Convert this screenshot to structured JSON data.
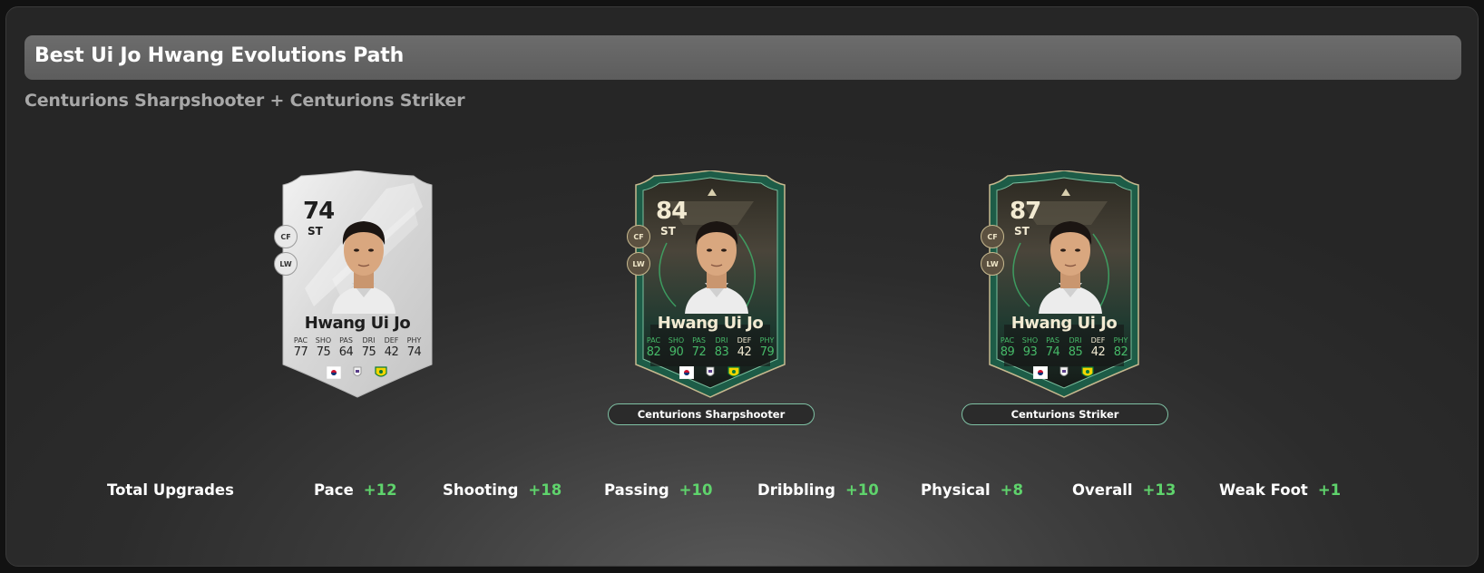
{
  "header": {
    "title": "Best Ui Jo Hwang Evolutions Path",
    "subtitle": "Centurions Sharpshooter + Centurions Striker"
  },
  "colors": {
    "accent_green": "#5fd36c",
    "button_border": "#7fc1a4",
    "card_green": "#1f5a45"
  },
  "cards": [
    {
      "rating": "74",
      "position": "ST",
      "alt_positions": [
        "CF",
        "LW"
      ],
      "name": "Hwang Ui Jo",
      "stats": [
        {
          "label": "PAC",
          "value": "77"
        },
        {
          "label": "SHO",
          "value": "75"
        },
        {
          "label": "PAS",
          "value": "64"
        },
        {
          "label": "DRI",
          "value": "75"
        },
        {
          "label": "DEF",
          "value": "42"
        },
        {
          "label": "PHY",
          "value": "74"
        }
      ],
      "icons": [
        "korea-flag-icon",
        "league-icon",
        "club-crest-icon"
      ]
    },
    {
      "rating": "84",
      "position": "ST",
      "alt_positions": [
        "CF",
        "LW"
      ],
      "name": "Hwang Ui Jo",
      "stats": [
        {
          "label": "PAC",
          "value": "82"
        },
        {
          "label": "SHO",
          "value": "90"
        },
        {
          "label": "PAS",
          "value": "72"
        },
        {
          "label": "DRI",
          "value": "83"
        },
        {
          "label": "DEF",
          "value": "42"
        },
        {
          "label": "PHY",
          "value": "79"
        }
      ],
      "evolution": "Centurions Sharpshooter"
    },
    {
      "rating": "87",
      "position": "ST",
      "alt_positions": [
        "CF",
        "LW"
      ],
      "name": "Hwang Ui Jo",
      "stats": [
        {
          "label": "PAC",
          "value": "89"
        },
        {
          "label": "SHO",
          "value": "93"
        },
        {
          "label": "PAS",
          "value": "74"
        },
        {
          "label": "DRI",
          "value": "85"
        },
        {
          "label": "DEF",
          "value": "42"
        },
        {
          "label": "PHY",
          "value": "82"
        }
      ],
      "evolution": "Centurions Striker"
    }
  ],
  "upgrades": {
    "label": "Total Upgrades",
    "items": [
      {
        "name": "Pace",
        "value": "+12"
      },
      {
        "name": "Shooting",
        "value": "+18"
      },
      {
        "name": "Passing",
        "value": "+10"
      },
      {
        "name": "Dribbling",
        "value": "+10"
      },
      {
        "name": "Physical",
        "value": "+8"
      },
      {
        "name": "Overall",
        "value": "+13"
      },
      {
        "name": "Weak Foot",
        "value": "+1"
      }
    ]
  }
}
